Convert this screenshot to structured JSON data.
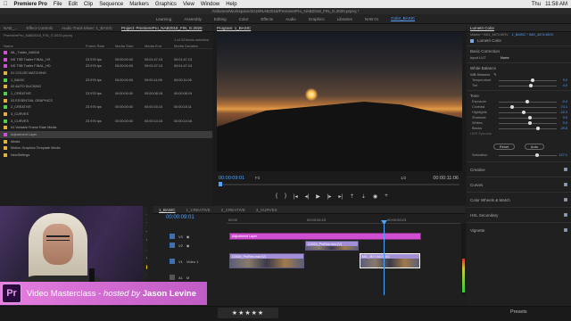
{
  "mac_menu": {
    "apple": "",
    "app": "Premiere Pro",
    "items": [
      "File",
      "Edit",
      "Clip",
      "Sequence",
      "Markers",
      "Graphics",
      "View",
      "Window",
      "Help"
    ],
    "right": [
      "Thu",
      "11:58 AM"
    ]
  },
  "title_path": "/Volumes/Workspace/2018/NAB2018/PremierePro_NAB2018_FIN_G.2020.prproj *",
  "workspaces": [
    "Learning",
    "Assembly",
    "Editing",
    "Color",
    "Effects",
    "Audio",
    "Graphics",
    "Libraries",
    "NAB 01",
    "Color_BASIC"
  ],
  "active_workspace": "Color_BASIC",
  "source_tabs": [
    "Effect Controls",
    "Audio Track Mixer: 1_BASIC",
    "Project: PremierePro_NAB2018_FIN_G.2020"
  ],
  "source_left_tab": "NAB_...",
  "project": {
    "file": "PremierePro_NAB2018_FIN_G.2020.prproj",
    "items_selected": "1 of 23 items selected",
    "columns": [
      "Name",
      "Frame Rate",
      "Media Start",
      "Media End",
      "Media Duration"
    ],
    "rows": [
      {
        "name": "ML_Trailer_NAB18",
        "rate": "",
        "start": "",
        "end": "",
        "dur": "",
        "color": "#d04fd0",
        "sel": false
      },
      {
        "name": "NS TSB Trailer FINAL_HS",
        "rate": "23.976 fps",
        "start": "00:00:00:00",
        "end": "00:01:47:13",
        "dur": "00:01:47:13",
        "color": "#d04fd0",
        "sel": false
      },
      {
        "name": "NS TSB Trailer FINAL_HD",
        "rate": "23.976 fps",
        "start": "00:00:00:00",
        "end": "00:01:47:13",
        "dur": "00:01:47:13",
        "color": "#d04fd0",
        "sel": false
      },
      {
        "name": "01 COLOR MATCHING",
        "rate": "",
        "start": "",
        "end": "",
        "dur": "",
        "color": "#e0b040",
        "sel": false
      },
      {
        "name": "1_BASIC",
        "rate": "23.976 fps",
        "start": "00:00:00:00",
        "end": "00:00:11:06",
        "dur": "00:00:11:06",
        "color": "#4fd04f",
        "sel": false
      },
      {
        "name": "02 AUTO DUCKING",
        "rate": "",
        "start": "",
        "end": "",
        "dur": "",
        "color": "#e0b040",
        "sel": false
      },
      {
        "name": "1_CREATIVE",
        "rate": "23.976 fps",
        "start": "00:00:00:00",
        "end": "00:00:08:18",
        "dur": "00:00:08:19",
        "color": "#4fd04f",
        "sel": false
      },
      {
        "name": "03 ESSENTIAL GRAPHICS",
        "rate": "",
        "start": "",
        "end": "",
        "dur": "",
        "color": "#e0b040",
        "sel": false
      },
      {
        "name": "2_CREATIVE",
        "rate": "23.976 fps",
        "start": "00:00:00:00",
        "end": "00:00:15:10",
        "dur": "00:00:15:11",
        "color": "#4fd04f",
        "sel": false
      },
      {
        "name": "3_CURVES",
        "rate": "",
        "start": "",
        "end": "",
        "dur": "",
        "color": "#e0b040",
        "sel": false
      },
      {
        "name": "3_CURVES",
        "rate": "23.976 fps",
        "start": "00:00:00:00",
        "end": "00:00:14:15",
        "dur": "00:00:14:16",
        "color": "#4fd04f",
        "sel": false
      },
      {
        "name": "04 Variable Frame Rate Media",
        "rate": "",
        "start": "",
        "end": "",
        "dur": "",
        "color": "#e0b040",
        "sel": false
      },
      {
        "name": "Adjustment Layer",
        "rate": "",
        "start": "",
        "end": "",
        "dur": "",
        "color": "#d04fd0",
        "sel": true
      },
      {
        "name": "Media",
        "rate": "",
        "start": "",
        "end": "",
        "dur": "",
        "color": "#e0b040",
        "sel": false
      },
      {
        "name": "Motion Graphics Template Media",
        "rate": "",
        "start": "",
        "end": "",
        "dur": "",
        "color": "#e0b040",
        "sel": false
      },
      {
        "name": "NewSettings",
        "rate": "",
        "start": "",
        "end": "",
        "dur": "",
        "color": "#e0b040",
        "sel": false
      }
    ]
  },
  "program": {
    "tab": "Program: 1_BASIC",
    "timecode": "00:00:09:01",
    "fit": "Fit",
    "resolution": "1/2",
    "duration": "00:00:11:06"
  },
  "timeline": {
    "tabs": [
      "1_BASIC",
      "1_CREATIVE",
      "2_CREATIVE",
      "3_CURVES"
    ],
    "timecode": "00:00:09:01",
    "ruler": [
      "00:00",
      "00:00:04:23",
      "00:00:09:23"
    ],
    "tracks": [
      "V3",
      "V2",
      "V1",
      "A1",
      "A2"
    ],
    "track_name_v1": "Video 1",
    "clips": {
      "adjustment": "Adjustment Layer",
      "c1": "C0024_ProRes.mov [V]",
      "c2": "C0024_ProRes.mov [V]",
      "c3": "MG_4674.MOV [V]"
    }
  },
  "lumetri": {
    "panel_tab": "Lumetri Color",
    "master": "Master * IMG_4674.MOV",
    "clip": "1_BASIC * IMG_4674.MOV",
    "title": "Lumetri Color",
    "basic": "Basic Correction",
    "input_lut_label": "Input LUT",
    "input_lut": "None",
    "white_balance": "White Balance",
    "wb_selector": "WB Selector",
    "sliders_wb": [
      {
        "label": "Temperature",
        "value": "9.0",
        "pos": 0.55
      },
      {
        "label": "Tint",
        "value": "4.0",
        "pos": 0.52
      }
    ],
    "tone": "Tone",
    "sliders_tone": [
      {
        "label": "Exposure",
        "value": "-0.4",
        "pos": 0.46
      },
      {
        "label": "Contrast",
        "value": "-74.1",
        "pos": 0.2
      },
      {
        "label": "Highlights",
        "value": "-22.3",
        "pos": 0.4
      },
      {
        "label": "Shadows",
        "value": "0.0",
        "pos": 0.5
      },
      {
        "label": "Whites",
        "value": "0.0",
        "pos": 0.5
      },
      {
        "label": "Blacks",
        "value": "29.5",
        "pos": 0.64
      }
    ],
    "hdr_specular": "HDR Specular",
    "reset": "Reset",
    "auto": "Auto",
    "saturation_label": "Saturation",
    "saturation": "127.1",
    "saturation_pos": 0.63,
    "sections": [
      "Creative",
      "Curves",
      "Color Wheels & Match",
      "HSL Secondary",
      "Vignette"
    ]
  },
  "lower_third": {
    "logo": "Pr",
    "title": "Video Masterclass",
    "sep": " - ",
    "hosted": "hosted by",
    "host": "Jason Levine"
  },
  "status": {
    "stars": "★★★★★",
    "presets": "Presets"
  }
}
